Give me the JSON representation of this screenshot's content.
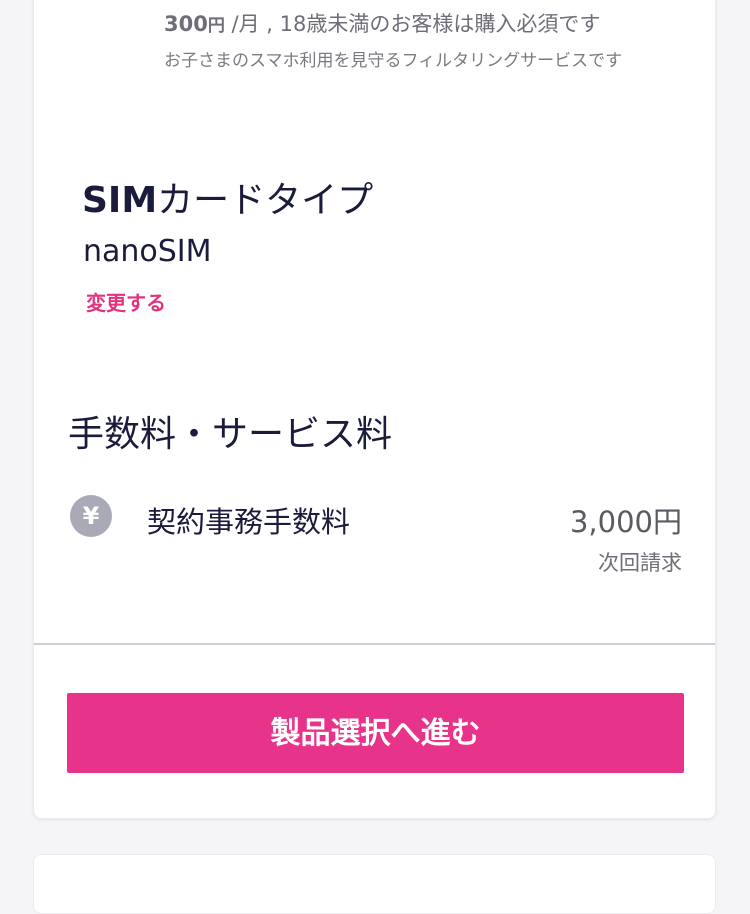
{
  "filtering": {
    "price_amount": "300",
    "price_yen": "円",
    "price_rest": " /月 , 18歳未満のお客様は購入必須です",
    "description": "お子さまのスマホ利用を見守るフィルタリングサービスです"
  },
  "sim": {
    "title_bold": "SIM",
    "title_rest": "カードタイプ",
    "value": "nanoSIM",
    "change_label": "変更する"
  },
  "fees": {
    "heading": "手数料・サービス料",
    "items": [
      {
        "icon": "yen-icon",
        "icon_glyph": "¥",
        "name": "契約事務手数料",
        "amount": "3,000円",
        "note": "次回請求"
      }
    ]
  },
  "actions": {
    "proceed_label": "製品選択へ進む"
  },
  "colors": {
    "accent": "#e8338a",
    "link": "#e5327f",
    "text_dark": "#1b1b3b",
    "icon_bg": "#a9a9b8"
  }
}
